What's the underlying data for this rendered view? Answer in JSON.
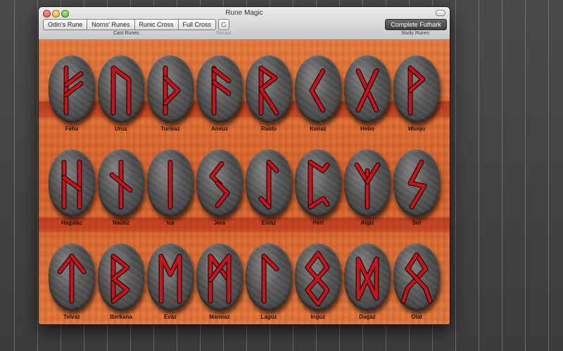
{
  "window": {
    "title": "Rune Magic"
  },
  "toolbar": {
    "cast_buttons": [
      "Odin's Rune",
      "Norns' Runes",
      "Runic Cross",
      "Full Cross"
    ],
    "cast_label": "Cast Runes",
    "recast_label": "Recast",
    "recast_icon": "refresh-icon",
    "study_button": "Complete Futhark",
    "study_label": "Study Runes"
  },
  "runes": [
    {
      "name": "Fehu",
      "glyph": "fehu"
    },
    {
      "name": "Uruz",
      "glyph": "uruz"
    },
    {
      "name": "Turisaz",
      "glyph": "thurisaz"
    },
    {
      "name": "Ansuz",
      "glyph": "ansuz"
    },
    {
      "name": "Raido",
      "glyph": "raido"
    },
    {
      "name": "Kenaz",
      "glyph": "kenaz"
    },
    {
      "name": "Hebo",
      "glyph": "gebo"
    },
    {
      "name": "Wunjo",
      "glyph": "wunjo"
    },
    {
      "name": "Hagalaz",
      "glyph": "hagalaz"
    },
    {
      "name": "Nautiz",
      "glyph": "nauthiz"
    },
    {
      "name": "Isa",
      "glyph": "isa"
    },
    {
      "name": "Jera",
      "glyph": "jera"
    },
    {
      "name": "Eivaz",
      "glyph": "eihwaz"
    },
    {
      "name": "Pert",
      "glyph": "perthro"
    },
    {
      "name": "Algiz",
      "glyph": "algiz"
    },
    {
      "name": "Sol",
      "glyph": "sowilo"
    },
    {
      "name": "Teivaz",
      "glyph": "tiwaz"
    },
    {
      "name": "Berkana",
      "glyph": "berkana"
    },
    {
      "name": "Evaz",
      "glyph": "ehwaz"
    },
    {
      "name": "Mannaz",
      "glyph": "mannaz"
    },
    {
      "name": "Laguz",
      "glyph": "laguz"
    },
    {
      "name": "Inguz",
      "glyph": "inguz"
    },
    {
      "name": "Dagaz",
      "glyph": "dagaz"
    },
    {
      "name": "Otal",
      "glyph": "othala"
    }
  ],
  "colors": {
    "rune_red": "#c4161c",
    "stone": "#555555",
    "board": "#e06a32"
  }
}
